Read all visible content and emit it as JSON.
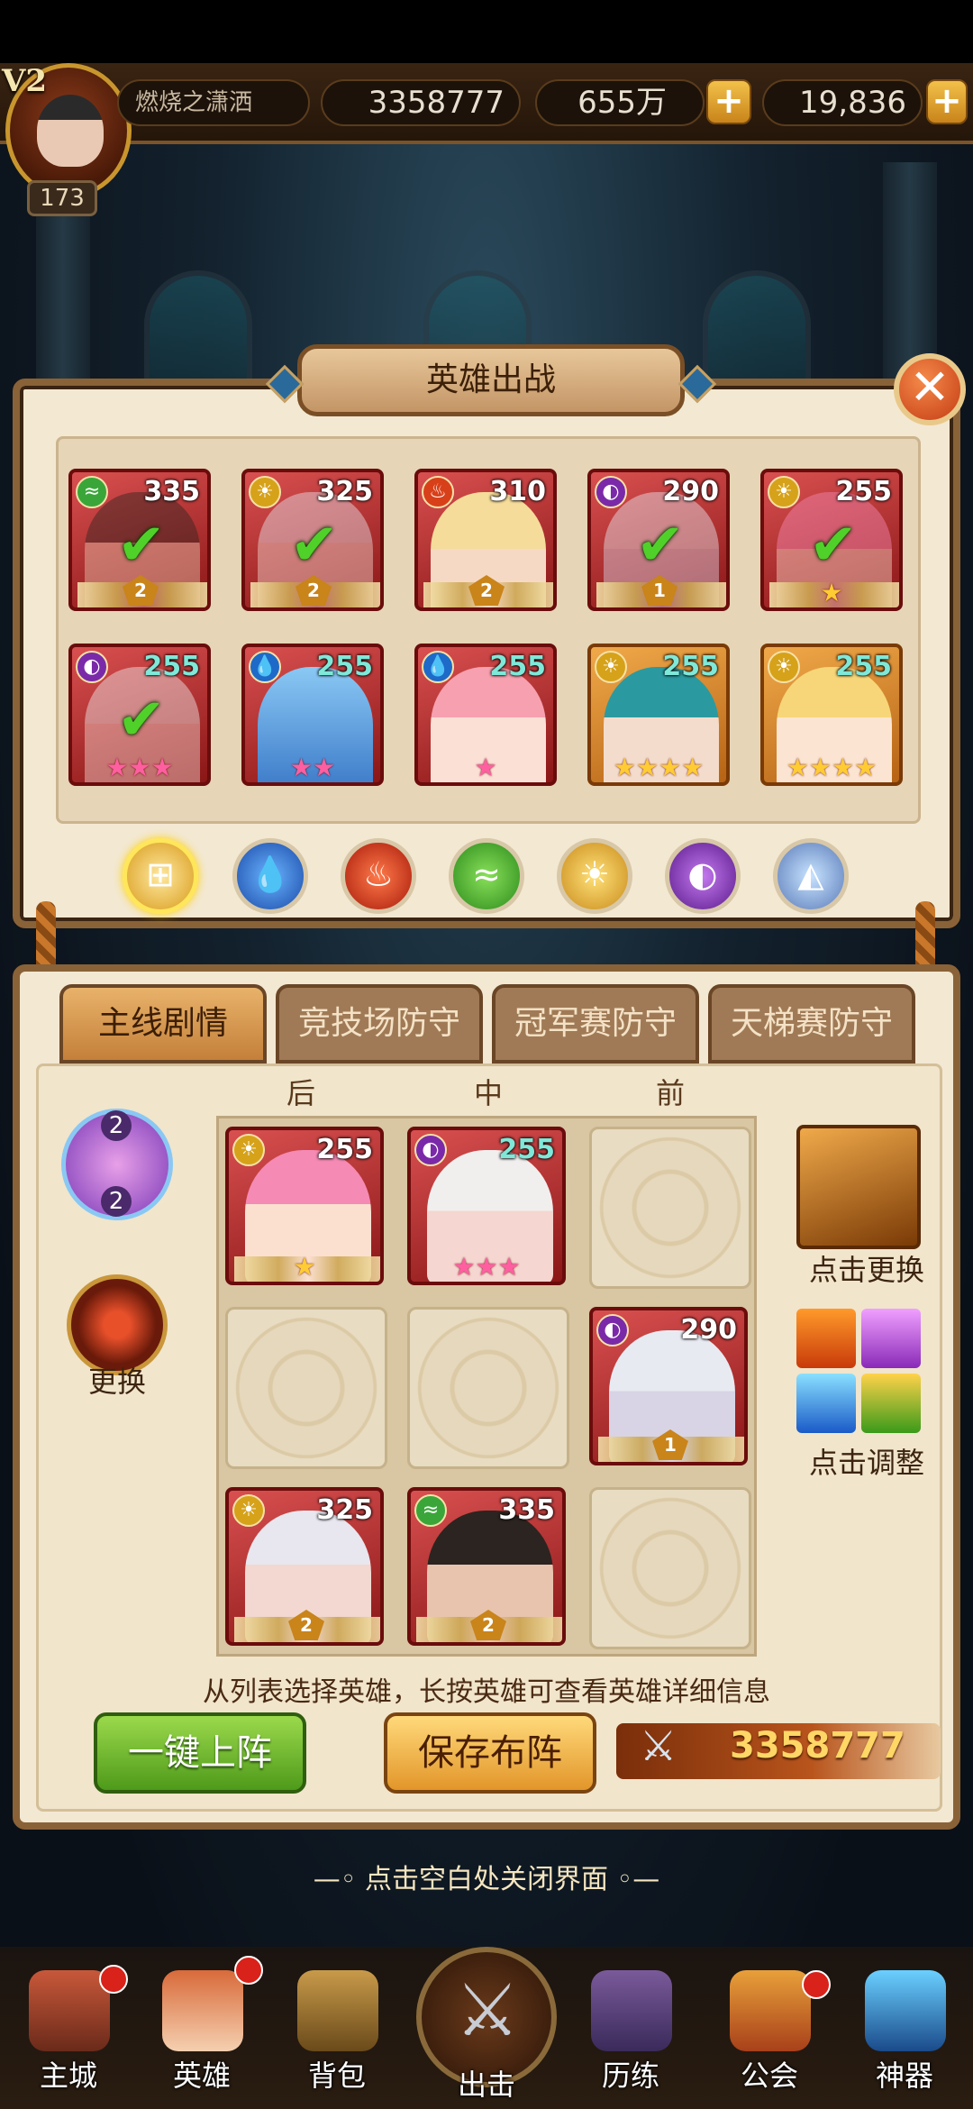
{
  "top": {
    "vip": "V2",
    "level": "173",
    "player_name": "燃烧之潇洒",
    "power": "3358777",
    "gold": "655万",
    "gems": "19,836"
  },
  "panel": {
    "title": "英雄出战",
    "roster": [
      {
        "level": "335",
        "element": "wind",
        "deployed": true,
        "rank": "2"
      },
      {
        "level": "325",
        "element": "light",
        "deployed": true,
        "rank": "2"
      },
      {
        "level": "310",
        "element": "fire",
        "deployed": false,
        "rank": "2"
      },
      {
        "level": "290",
        "element": "dark",
        "deployed": true,
        "rank": "1"
      },
      {
        "level": "255",
        "element": "light",
        "deployed": true,
        "rank": ""
      },
      {
        "level": "255",
        "element": "dark",
        "deployed": true,
        "stars": "★★★"
      },
      {
        "level": "255",
        "element": "water",
        "deployed": false,
        "stars": "★★"
      },
      {
        "level": "255",
        "element": "water",
        "deployed": false,
        "stars": "★"
      },
      {
        "level": "255",
        "element": "light",
        "deployed": false,
        "stars": "★★★★"
      },
      {
        "level": "255",
        "element": "light",
        "deployed": false,
        "stars": "★★★★"
      }
    ],
    "filters": [
      "all",
      "water",
      "fire",
      "wind",
      "light",
      "dark",
      "neutral"
    ]
  },
  "tabs": [
    "主线剧情",
    "竞技场防守",
    "冠军赛防守",
    "天梯赛防守"
  ],
  "formation": {
    "row_labels": [
      "后",
      "中",
      "前"
    ],
    "cells": [
      {
        "level": "255",
        "element": "light",
        "stars": "★"
      },
      {
        "level": "255",
        "element": "dark",
        "stars": "★★★"
      },
      null,
      null,
      null,
      {
        "level": "290",
        "element": "dark",
        "rank": "1"
      },
      {
        "level": "325",
        "element": "light",
        "rank": "2"
      },
      {
        "level": "335",
        "element": "wind",
        "rank": "2"
      },
      null
    ],
    "formation_badge_top": "2",
    "formation_badge_bottom": "2",
    "change_label": "更换",
    "weapon_label": "点击更换",
    "skills_label": "点击调整",
    "hint": "从列表选择英雄，长按英雄可查看英雄详细信息",
    "auto_button": "一键上阵",
    "save_button": "保存布阵",
    "team_power": "3358777"
  },
  "close_hint": "—◦ 点击空白处关闭界面 ◦—",
  "nav": [
    {
      "label": "主城",
      "dot": true
    },
    {
      "label": "英雄",
      "dot": true
    },
    {
      "label": "背包",
      "dot": false
    },
    {
      "label": "出击",
      "dot": false
    },
    {
      "label": "历练",
      "dot": false
    },
    {
      "label": "公会",
      "dot": true
    },
    {
      "label": "神器",
      "dot": false
    }
  ],
  "colors": {
    "panel_bg": "#f3e8d2",
    "panel_border": "#8a6238",
    "green_check": "#4fd12a",
    "level_teal": "#7fe8d8"
  }
}
